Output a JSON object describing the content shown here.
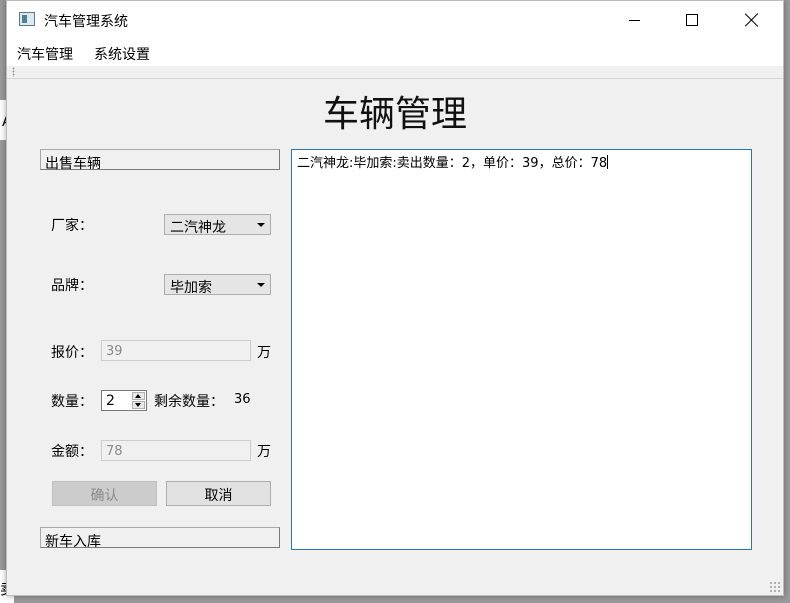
{
  "background": {
    "left_glyph": "A",
    "bottom_glyph": "卖"
  },
  "window": {
    "title": "汽车管理系统",
    "icon": "app-window-icon",
    "controls": [
      "minimize-icon",
      "maximize-icon",
      "close-icon"
    ]
  },
  "menu": {
    "items": [
      "汽车管理",
      "系统设置"
    ]
  },
  "main": {
    "title": "车辆管理"
  },
  "sell": {
    "header": "出售车辆",
    "manufacturer_label": "厂家：",
    "manufacturer_value": "二汽神龙",
    "brand_label": "品牌：",
    "brand_value": "毕加索",
    "price_label": "报价：",
    "price_value": "39",
    "price_unit": "万",
    "quantity_label": "数量：",
    "quantity_value": "2",
    "remaining_label": "剩余数量：",
    "remaining_value": "36",
    "amount_label": "金额：",
    "amount_value": "78",
    "amount_unit": "万",
    "confirm_label": "确认",
    "cancel_label": "取消"
  },
  "stock": {
    "header": "新车入库"
  },
  "log": {
    "text": "二汽神龙:毕加索:卖出数量：2，单价：39，总价：78"
  },
  "colors": {
    "accent_border": "#2b74b8",
    "window_bg": "#f0f0f0"
  }
}
